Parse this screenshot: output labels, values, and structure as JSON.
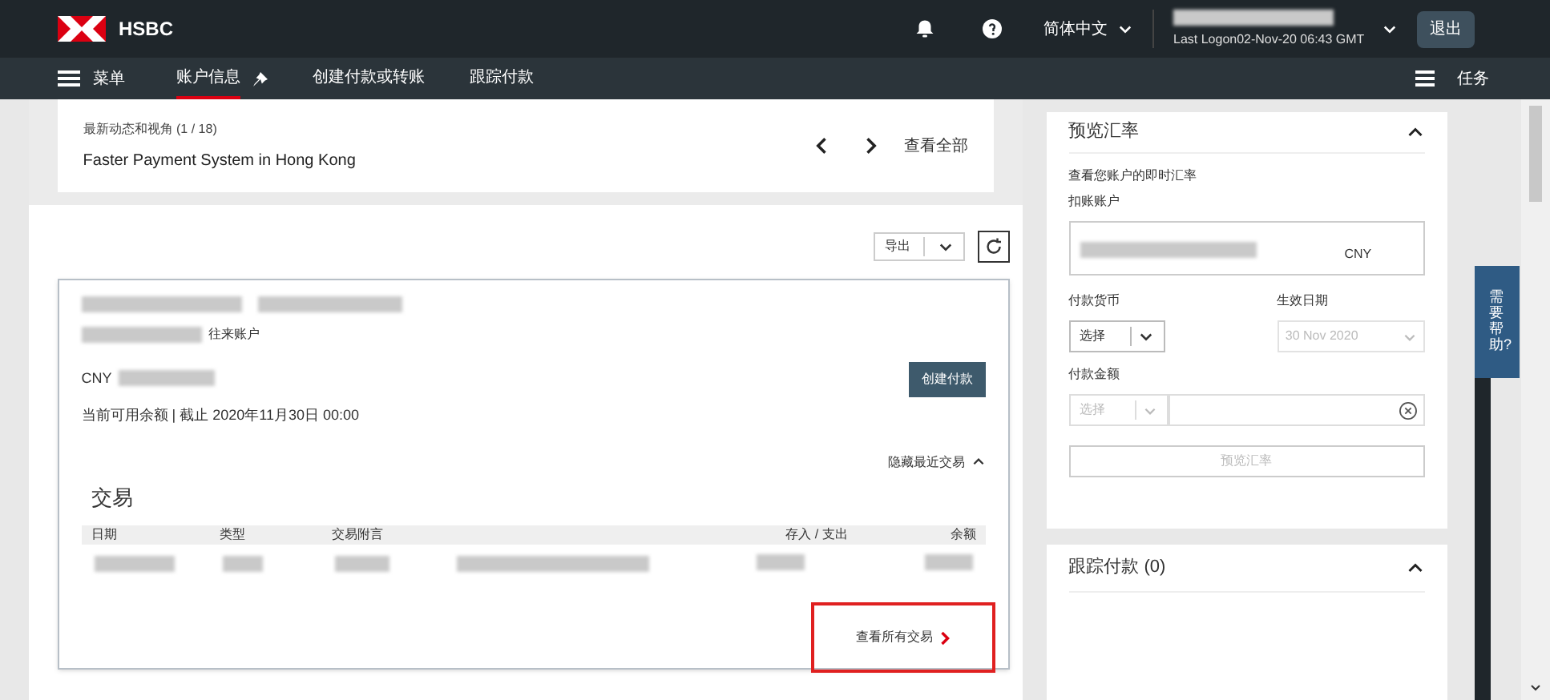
{
  "header": {
    "brand": "HSBC",
    "language": "简体中文",
    "last_logon": "Last Logon02-Nov-20 06:43 GMT",
    "logout": "退出"
  },
  "nav": {
    "menu": "菜单",
    "tabs": [
      {
        "label": "账户信息",
        "selected": true,
        "pinned": true
      },
      {
        "label": "创建付款或转账",
        "selected": false,
        "pinned": false
      },
      {
        "label": "跟踪付款",
        "selected": false,
        "pinned": false
      }
    ],
    "tasks": "任务"
  },
  "news": {
    "label": "最新动态和视角",
    "count": "(1 / 18)",
    "headline": "Faster Payment System in Hong Kong",
    "view_all": "查看全部"
  },
  "export": {
    "label": "导出"
  },
  "account": {
    "type": "往来账户",
    "currency": "CNY",
    "create_payment": "创建付款",
    "balance_note": "当前可用余额 | 截止 2020年11月30日 00:00",
    "hide_recent": "隐藏最近交易",
    "expanded": true,
    "section_title": "交易",
    "columns": [
      "日期",
      "类型",
      "交易附言",
      "存入 / 支出",
      "余额"
    ],
    "view_all": {
      "label": "查看所有交易",
      "highlighted": true
    }
  },
  "rates": {
    "title": "预览汇率",
    "expanded": true,
    "description": "查看您账户的即时汇率",
    "debit_label": "扣账账户",
    "debit_currency": "CNY",
    "pay_currency": {
      "label": "付款货币",
      "value": "选择",
      "disabled": false
    },
    "effective_date": {
      "label": "生效日期",
      "value": "30 Nov 2020",
      "disabled": true
    },
    "amount": {
      "label": "付款金额",
      "currency": "选择",
      "disabled": true
    },
    "preview_button": {
      "label": "预览汇率",
      "disabled": true
    }
  },
  "tracking": {
    "title": "跟踪付款 (0)",
    "expanded": true
  },
  "help_tab": "需要帮助?"
}
